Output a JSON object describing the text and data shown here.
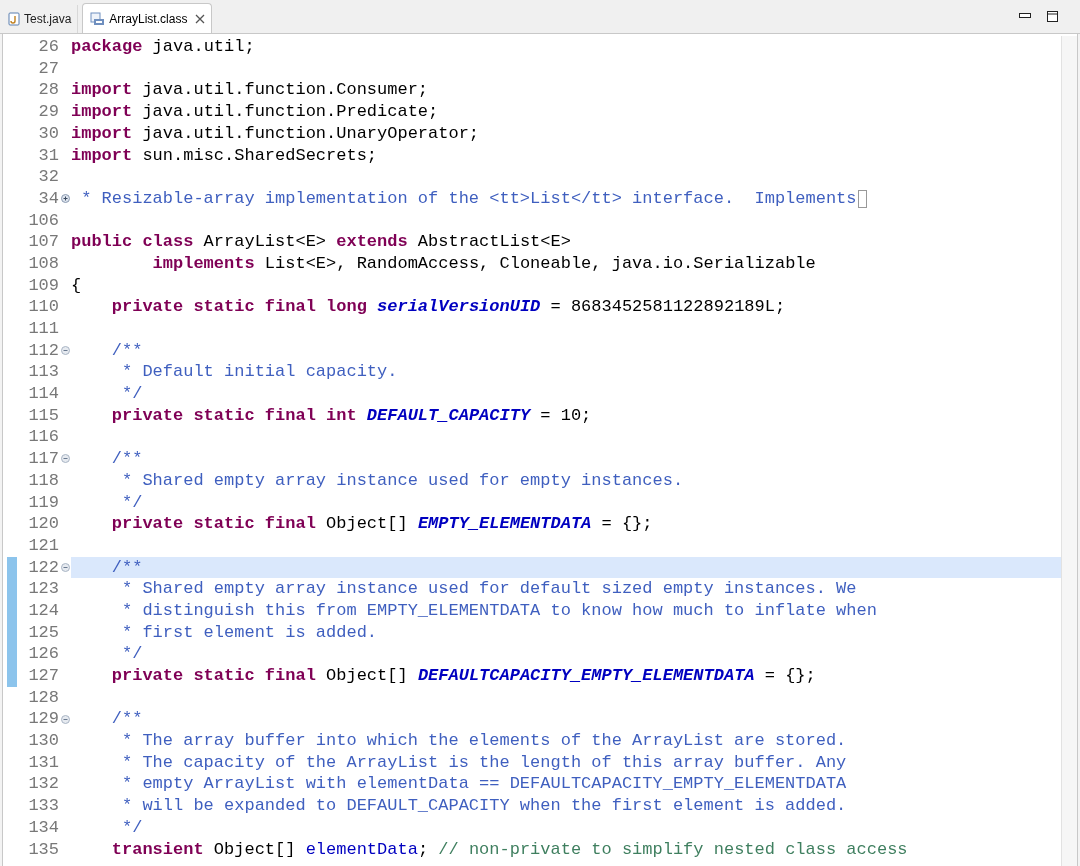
{
  "tabs": [
    {
      "label": "Test.java",
      "kind": "java",
      "selected": false,
      "closable": false
    },
    {
      "label": "ArrayList.class",
      "kind": "class",
      "selected": true,
      "closable": true
    }
  ],
  "lines": [
    {
      "number": "26",
      "current": false,
      "changed": false,
      "tokens": [
        {
          "kind": "kw",
          "t": "package"
        },
        {
          "kind": "text",
          "t": " java.util;"
        }
      ]
    },
    {
      "number": "27",
      "current": false,
      "changed": false
    },
    {
      "number": "28",
      "current": false,
      "changed": false,
      "tokens": [
        {
          "kind": "kw",
          "t": "import"
        },
        {
          "kind": "text",
          "t": " java.util.function.Consumer;"
        }
      ]
    },
    {
      "number": "29",
      "current": false,
      "changed": false,
      "tokens": [
        {
          "kind": "kw",
          "t": "import"
        },
        {
          "kind": "text",
          "t": " java.util.function.Predicate;"
        }
      ]
    },
    {
      "number": "30",
      "current": false,
      "changed": false,
      "tokens": [
        {
          "kind": "kw",
          "t": "import"
        },
        {
          "kind": "text",
          "t": " java.util.function.UnaryOperator;"
        }
      ]
    },
    {
      "number": "31",
      "current": false,
      "changed": false,
      "tokens": [
        {
          "kind": "kw",
          "t": "import"
        },
        {
          "kind": "text",
          "t": " sun.misc.SharedSecrets;"
        }
      ]
    },
    {
      "number": "32",
      "current": false,
      "changed": false
    },
    {
      "number": "34",
      "fold": {
        "kind": "collapsed"
      },
      "current": false,
      "changed": false,
      "tokens": [
        {
          "kind": "doc",
          "t": " * Resizable-array implementation of the <tt>List</tt> interface.  Implements"
        }
      ]
    },
    {
      "number": "106",
      "current": false,
      "changed": false
    },
    {
      "number": "107",
      "current": false,
      "changed": false,
      "tokens": [
        {
          "kind": "kw",
          "t": "public class"
        },
        {
          "kind": "text",
          "t": " ArrayList<E> "
        },
        {
          "kind": "kw",
          "t": "extends"
        },
        {
          "kind": "text",
          "t": " AbstractList<E>"
        }
      ]
    },
    {
      "number": "108",
      "current": false,
      "changed": false,
      "tokens": [
        {
          "kind": "kw",
          "t": "        implements"
        },
        {
          "kind": "text",
          "t": " List<E>, RandomAccess, Cloneable, java.io.Serializable"
        }
      ]
    },
    {
      "number": "109",
      "current": false,
      "changed": false,
      "tokens": [
        {
          "kind": "text",
          "t": "{"
        }
      ]
    },
    {
      "number": "110",
      "current": false,
      "changed": false,
      "tokens": [
        {
          "kind": "kw",
          "t": "    private static final long "
        },
        {
          "kind": "const",
          "t": "serialVersionUID"
        },
        {
          "kind": "text",
          "t": " = 8683452581122892189L;"
        }
      ]
    },
    {
      "number": "111",
      "current": false,
      "changed": false
    },
    {
      "number": "112",
      "fold": {
        "kind": "expanded"
      },
      "current": false,
      "changed": false,
      "tokens": [
        {
          "kind": "doc",
          "t": "    /**"
        }
      ]
    },
    {
      "number": "113",
      "current": false,
      "changed": false,
      "tokens": [
        {
          "kind": "doc",
          "t": "     * Default initial capacity."
        }
      ]
    },
    {
      "number": "114",
      "current": false,
      "changed": false,
      "tokens": [
        {
          "kind": "doc",
          "t": "     */"
        }
      ]
    },
    {
      "number": "115",
      "current": false,
      "changed": false,
      "tokens": [
        {
          "kind": "kw",
          "t": "    private static final int "
        },
        {
          "kind": "const",
          "t": "DEFAULT_CAPACITY"
        },
        {
          "kind": "text",
          "t": " = 10;"
        }
      ]
    },
    {
      "number": "116",
      "current": false,
      "changed": false
    },
    {
      "number": "117",
      "fold": {
        "kind": "expanded"
      },
      "current": false,
      "changed": false,
      "tokens": [
        {
          "kind": "doc",
          "t": "    /**"
        }
      ]
    },
    {
      "number": "118",
      "current": false,
      "changed": false,
      "tokens": [
        {
          "kind": "doc",
          "t": "     * Shared empty array instance used for empty instances."
        }
      ]
    },
    {
      "number": "119",
      "current": false,
      "changed": false,
      "tokens": [
        {
          "kind": "doc",
          "t": "     */"
        }
      ]
    },
    {
      "number": "120",
      "current": false,
      "changed": false,
      "tokens": [
        {
          "kind": "kw",
          "t": "    private static final"
        },
        {
          "kind": "text",
          "t": " Object[] "
        },
        {
          "kind": "const",
          "t": "EMPTY_ELEMENTDATA"
        },
        {
          "kind": "text",
          "t": " = {};"
        }
      ]
    },
    {
      "number": "121",
      "current": false,
      "changed": false
    },
    {
      "number": "122",
      "fold": {
        "kind": "expanded"
      },
      "current": true,
      "changed": true,
      "tokens": [
        {
          "kind": "doc",
          "t": "    /**"
        }
      ]
    },
    {
      "number": "123",
      "current": false,
      "changed": true,
      "tokens": [
        {
          "kind": "doc",
          "t": "     * Shared empty array instance used for default sized empty instances. We"
        }
      ]
    },
    {
      "number": "124",
      "current": false,
      "changed": true,
      "tokens": [
        {
          "kind": "doc",
          "t": "     * distinguish this from EMPTY_ELEMENTDATA to know how much to inflate when"
        }
      ]
    },
    {
      "number": "125",
      "current": false,
      "changed": true,
      "tokens": [
        {
          "kind": "doc",
          "t": "     * first element is added."
        }
      ]
    },
    {
      "number": "126",
      "current": false,
      "changed": true,
      "tokens": [
        {
          "kind": "doc",
          "t": "     */"
        }
      ]
    },
    {
      "number": "127",
      "current": false,
      "changed": true,
      "tokens": [
        {
          "kind": "kw",
          "t": "    private static final"
        },
        {
          "kind": "text",
          "t": " Object[] "
        },
        {
          "kind": "const",
          "t": "DEFAULTCAPACITY_EMPTY_ELEMENTDATA"
        },
        {
          "kind": "text",
          "t": " = {};"
        }
      ]
    },
    {
      "number": "128",
      "current": false,
      "changed": false
    },
    {
      "number": "129",
      "fold": {
        "kind": "expanded"
      },
      "current": false,
      "changed": false,
      "tokens": [
        {
          "kind": "doc",
          "t": "    /**"
        }
      ]
    },
    {
      "number": "130",
      "current": false,
      "changed": false,
      "tokens": [
        {
          "kind": "doc",
          "t": "     * The array buffer into which the elements of the ArrayList are stored."
        }
      ]
    },
    {
      "number": "131",
      "current": false,
      "changed": false,
      "tokens": [
        {
          "kind": "doc",
          "t": "     * The capacity of the ArrayList is the length of this array buffer. Any"
        }
      ]
    },
    {
      "number": "132",
      "current": false,
      "changed": false,
      "tokens": [
        {
          "kind": "doc",
          "t": "     * empty ArrayList with elementData == DEFAULTCAPACITY_EMPTY_ELEMENTDATA"
        }
      ]
    },
    {
      "number": "133",
      "current": false,
      "changed": false,
      "tokens": [
        {
          "kind": "doc",
          "t": "     * will be expanded to DEFAULT_CAPACITY when the first element is added."
        }
      ]
    },
    {
      "number": "134",
      "current": false,
      "changed": false,
      "tokens": [
        {
          "kind": "doc",
          "t": "     */"
        }
      ]
    },
    {
      "number": "135",
      "current": false,
      "changed": false,
      "tokens": [
        {
          "kind": "kw",
          "t": "    transient"
        },
        {
          "kind": "text",
          "t": " Object[] "
        },
        {
          "kind": "field",
          "t": "elementData"
        },
        {
          "kind": "text",
          "t": "; "
        },
        {
          "kind": "comment",
          "t": "// non-private to simplify nested class access"
        }
      ]
    }
  ]
}
